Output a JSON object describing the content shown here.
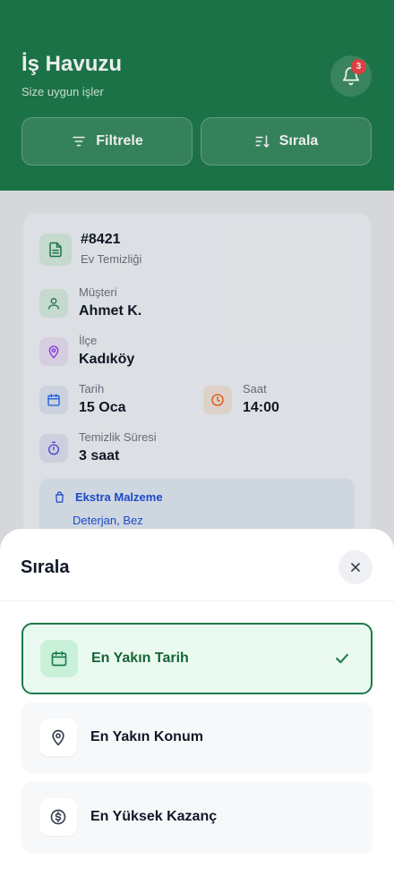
{
  "header": {
    "title": "İş Havuzu",
    "subtitle": "Size uygun işler",
    "notification_count": "3",
    "filter_label": "Filtrele",
    "sort_label": "Sırala"
  },
  "job_card": {
    "order_number": "#8421",
    "service": "Ev Temizliği",
    "customer_label": "Müşteri",
    "customer_value": "Ahmet K.",
    "district_label": "İlçe",
    "district_value": "Kadıköy",
    "date_label": "Tarih",
    "date_value": "15 Oca",
    "time_label": "Saat",
    "time_value": "14:00",
    "duration_label": "Temizlik Süresi",
    "duration_value": "3 saat",
    "extra_title": "Ekstra Malzeme",
    "extra_items": "Deterjan, Bez"
  },
  "sort_sheet": {
    "title": "Sırala",
    "options": [
      {
        "label": "En Yakın Tarih",
        "icon": "calendar-icon",
        "selected": true
      },
      {
        "label": "En Yakın Konum",
        "icon": "location-pin-icon",
        "selected": false
      },
      {
        "label": "En Yüksek Kazanç",
        "icon": "dollar-coin-icon",
        "selected": false
      }
    ]
  },
  "colors": {
    "brand_green": "#1e7a4a",
    "badge_red": "#ef4444",
    "link_blue": "#1d4ed8"
  }
}
